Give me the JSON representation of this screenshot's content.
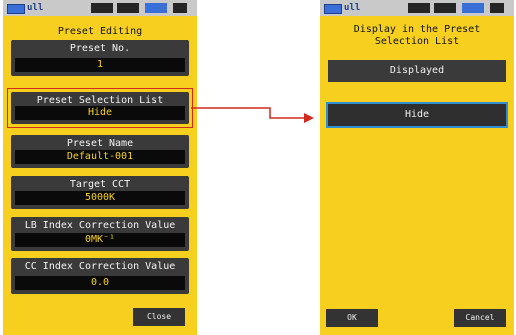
{
  "status": {
    "signal": "ull"
  },
  "left": {
    "title": "Preset Editing",
    "items": [
      {
        "label": "Preset No.",
        "value": "1"
      },
      {
        "label": "Preset Selection List",
        "value": "Hide"
      },
      {
        "label": "Preset Name",
        "value": "Default-001"
      },
      {
        "label": "Target CCT",
        "value": "5000K"
      },
      {
        "label": "LB Index Correction Value",
        "value": "0MK⁻¹"
      },
      {
        "label": "CC Index Correction Value",
        "value": "0.0"
      }
    ],
    "close_label": "Close"
  },
  "right": {
    "title_line1": "Display in the Preset",
    "title_line2": "Selection List",
    "options": [
      {
        "label": "Displayed",
        "selected": false
      },
      {
        "label": "Hide",
        "selected": true
      }
    ],
    "ok_label": "OK",
    "cancel_label": "Cancel"
  },
  "colors": {
    "background": "#f7cf1f",
    "panel": "#3a3a3a",
    "value_text": "#f5d21e",
    "highlight": "#d12a1f",
    "selection": "#2f8fd1"
  }
}
